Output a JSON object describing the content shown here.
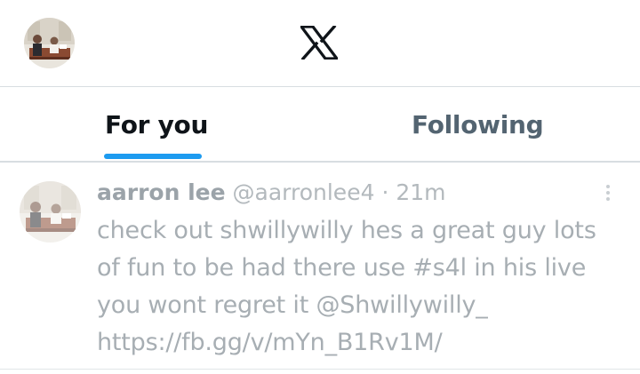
{
  "header": {
    "logo_icon": "x-logo-icon",
    "avatar_icon": "profile-avatar"
  },
  "tabs": [
    {
      "label": "For you",
      "active": true
    },
    {
      "label": "Following",
      "active": false
    }
  ],
  "colors": {
    "accent": "#1d9bf0",
    "text_primary": "#0f1419",
    "text_secondary": "#536471"
  },
  "post": {
    "author_name": "aarron lee",
    "author_handle": "@aarronlee4",
    "separator": "·",
    "time": "21m",
    "text_lines": [
      "check out shwillywilly hes a great guy lots",
      "of fun to be had there use #s4l in his live",
      "you wont regret it @Shwillywilly_",
      "https://fb.gg/v/mYn_B1Rv1M/"
    ]
  }
}
